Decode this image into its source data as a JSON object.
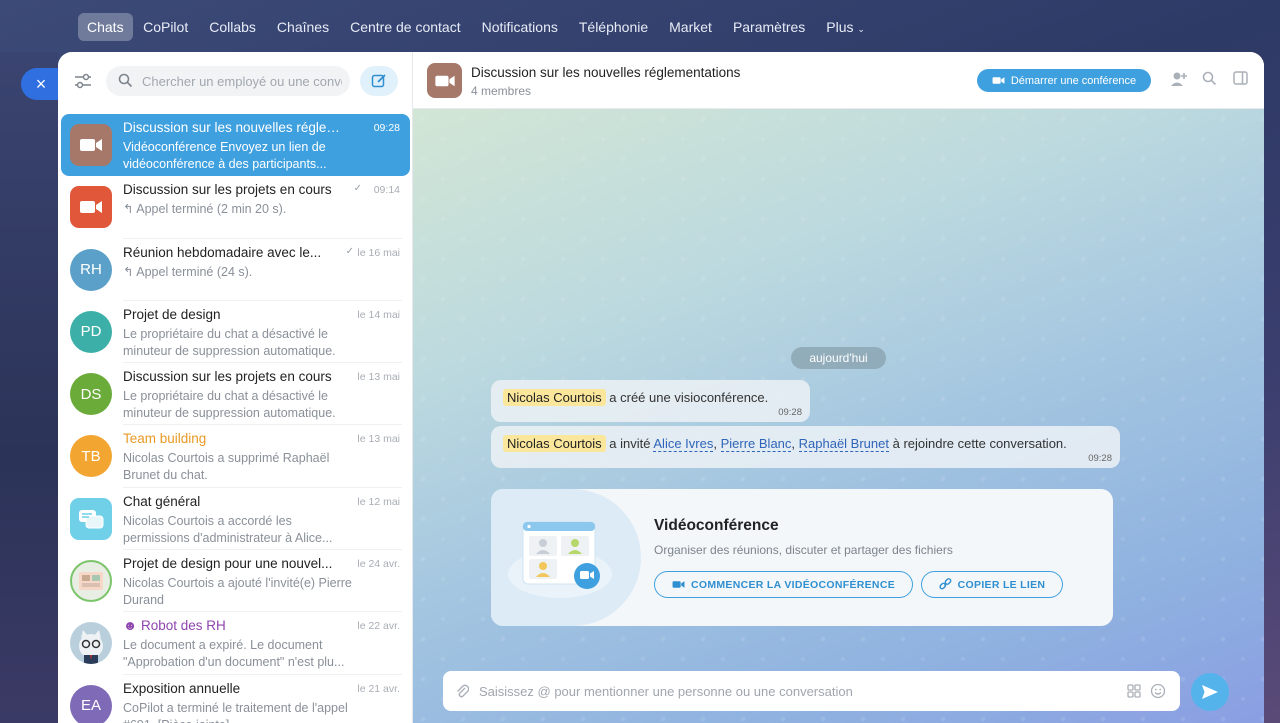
{
  "nav": {
    "items": [
      {
        "label": "Chats",
        "active": true
      },
      {
        "label": "CoPilot"
      },
      {
        "label": "Collabs"
      },
      {
        "label": "Chaînes"
      },
      {
        "label": "Centre de contact"
      },
      {
        "label": "Notifications"
      },
      {
        "label": "Téléphonie"
      },
      {
        "label": "Market"
      },
      {
        "label": "Paramètres"
      },
      {
        "label": "Plus"
      }
    ]
  },
  "close_label": "×",
  "search": {
    "placeholder": "Chercher un employé ou une conve"
  },
  "chats": [
    {
      "title": "Discussion sur les nouvelles réglem...",
      "time": "09:28",
      "preview": "Vidéoconférence Envoyez un lien de vidéoconférence à des participants...",
      "avatar": "video",
      "avatar_color": "#a5786a",
      "active": true
    },
    {
      "title": "Discussion sur les projets en cours",
      "time": "09:14",
      "preview": "↰ Appel terminé (2 min 20 s).",
      "avatar": "video",
      "avatar_color": "#e0573a",
      "check": "✓"
    },
    {
      "title": "Réunion hebdomadaire avec le...",
      "time": "le 16 mai",
      "preview": "↰ Appel terminé (24 s).",
      "avatar": "RH",
      "avatar_color": "#5aa0c8",
      "check": "✓"
    },
    {
      "title": "Projet de design",
      "time": "le 14 mai",
      "preview": "Le propriétaire du chat a désactivé le minuteur de suppression automatique.",
      "avatar": "PD",
      "avatar_color": "#3cb0a8"
    },
    {
      "title": "Discussion sur les projets en cours",
      "time": "le 13 mai",
      "preview": "Le propriétaire du chat a désactivé le minuteur de suppression automatique.",
      "avatar": "DS",
      "avatar_color": "#6aab3a"
    },
    {
      "title": "Team building",
      "time": "le 13 mai",
      "preview": "Nicolas Courtois a supprimé Raphaël Brunet du chat.",
      "avatar": "TB",
      "avatar_color": "#f2a531",
      "title_color": "#e89a25"
    },
    {
      "title": "Chat général",
      "time": "le 12 mai",
      "preview": "Nicolas Courtois a accordé les permissions d'administrateur à Alice...",
      "avatar": "chat",
      "avatar_color": "#6fd0e8"
    },
    {
      "title": "Projet de design pour une nouvel...",
      "time": "le 24 avr.",
      "preview": "Nicolas Courtois a ajouté l'invité(e) Pierre Durand",
      "avatar": "img",
      "avatar_color": "#cfd8c8"
    },
    {
      "title": "Robot des RH",
      "time": "le 22 avr.",
      "preview": "Le document a expiré. Le document \"Approbation d'un document\" n'est plu...",
      "avatar": "robot",
      "avatar_color": "#9ab5c8",
      "title_color": "#8e44ad"
    },
    {
      "title": "Exposition annuelle",
      "time": "le 21 avr.",
      "preview": "CoPilot a terminé le traitement de l'appel #691, [Pièce jointe]",
      "avatar": "EA",
      "avatar_color": "#7f6ab8"
    }
  ],
  "chat": {
    "title": "Discussion sur les nouvelles réglementations",
    "members": "4 membres",
    "conf_button": "Démarrer une conférence",
    "date": "aujourd'hui",
    "messages": [
      {
        "author": "Nicolas Courtois",
        "text": "a créé une visioconférence.",
        "time": "09:28"
      },
      {
        "author": "Nicolas Courtois",
        "text_before": "a invité",
        "users": [
          "Alice Ivres",
          "Pierre Blanc",
          "Raphaël Brunet"
        ],
        "text_after": "à rejoindre cette conversation.",
        "time": "09:28"
      }
    ],
    "card": {
      "title": "Vidéoconférence",
      "desc": "Organiser des réunions, discuter et partager des fichiers",
      "start_button": "COMMENCER LA VIDÉOCONFÉRENCE",
      "copy_button": "COPIER LE LIEN"
    },
    "input_placeholder": "Saisissez @ pour mentionner une personne ou une conversation"
  },
  "colors": {
    "accent": "#3fa0e0",
    "highlight": "#fbe79b",
    "link": "#2f64b8"
  }
}
